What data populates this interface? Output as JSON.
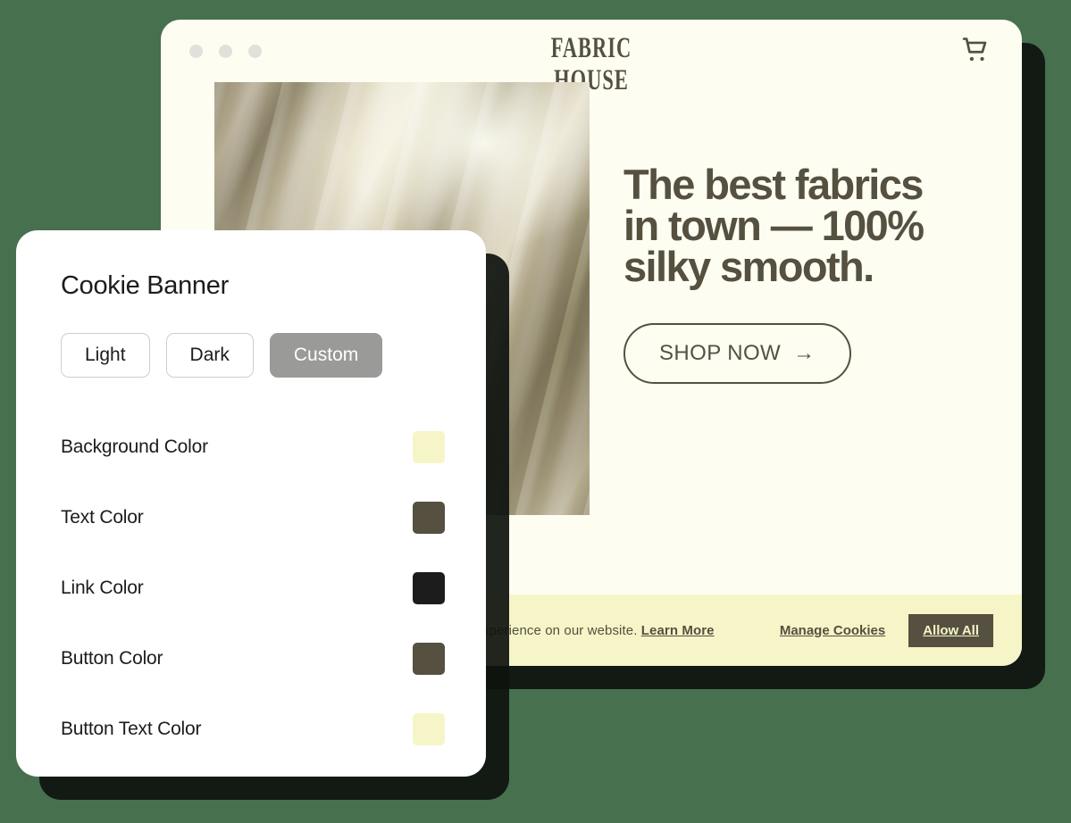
{
  "page": {
    "background_color": "#47704E"
  },
  "browser": {
    "titlebar": {
      "dots": [
        "dot-1",
        "dot-2",
        "dot-3"
      ],
      "dot_color": "#E1E1DB"
    },
    "logo": {
      "line1": "FABRIC",
      "line2": "HOUSE",
      "color": "#55503F"
    },
    "cart_icon": "shopping-cart-icon",
    "hero": {
      "image_alt": "silky beige satin fabric",
      "title": "The best fabrics\n in town  — 100%\nsilky smooth.",
      "cta_label": "SHOP NOW",
      "cta_arrow": "→"
    },
    "cookie_banner": {
      "text_prefix": "We use cookies to ensure you get the best experience on our website. ",
      "learn_more_label": "Learn More",
      "manage_label": "Manage Cookies",
      "allow_label": "Allow All",
      "background_color": "#F5F5C8",
      "text_color": "#55503F",
      "button_color": "#55503F",
      "button_text_color": "#F5F5C8"
    },
    "page_background_color": "#FDFDF2"
  },
  "settings": {
    "title": "Cookie Banner",
    "themes": [
      {
        "label": "Light",
        "active": false
      },
      {
        "label": "Dark",
        "active": false
      },
      {
        "label": "Custom",
        "active": true
      }
    ],
    "colors": [
      {
        "label": "Background Color",
        "value": "#F5F5C8"
      },
      {
        "label": "Text Color",
        "value": "#55503F"
      },
      {
        "label": "Link Color",
        "value": "#1C1C1C"
      },
      {
        "label": "Button Color",
        "value": "#55503F"
      },
      {
        "label": "Button Text Color",
        "value": "#F5F5C8"
      }
    ]
  }
}
